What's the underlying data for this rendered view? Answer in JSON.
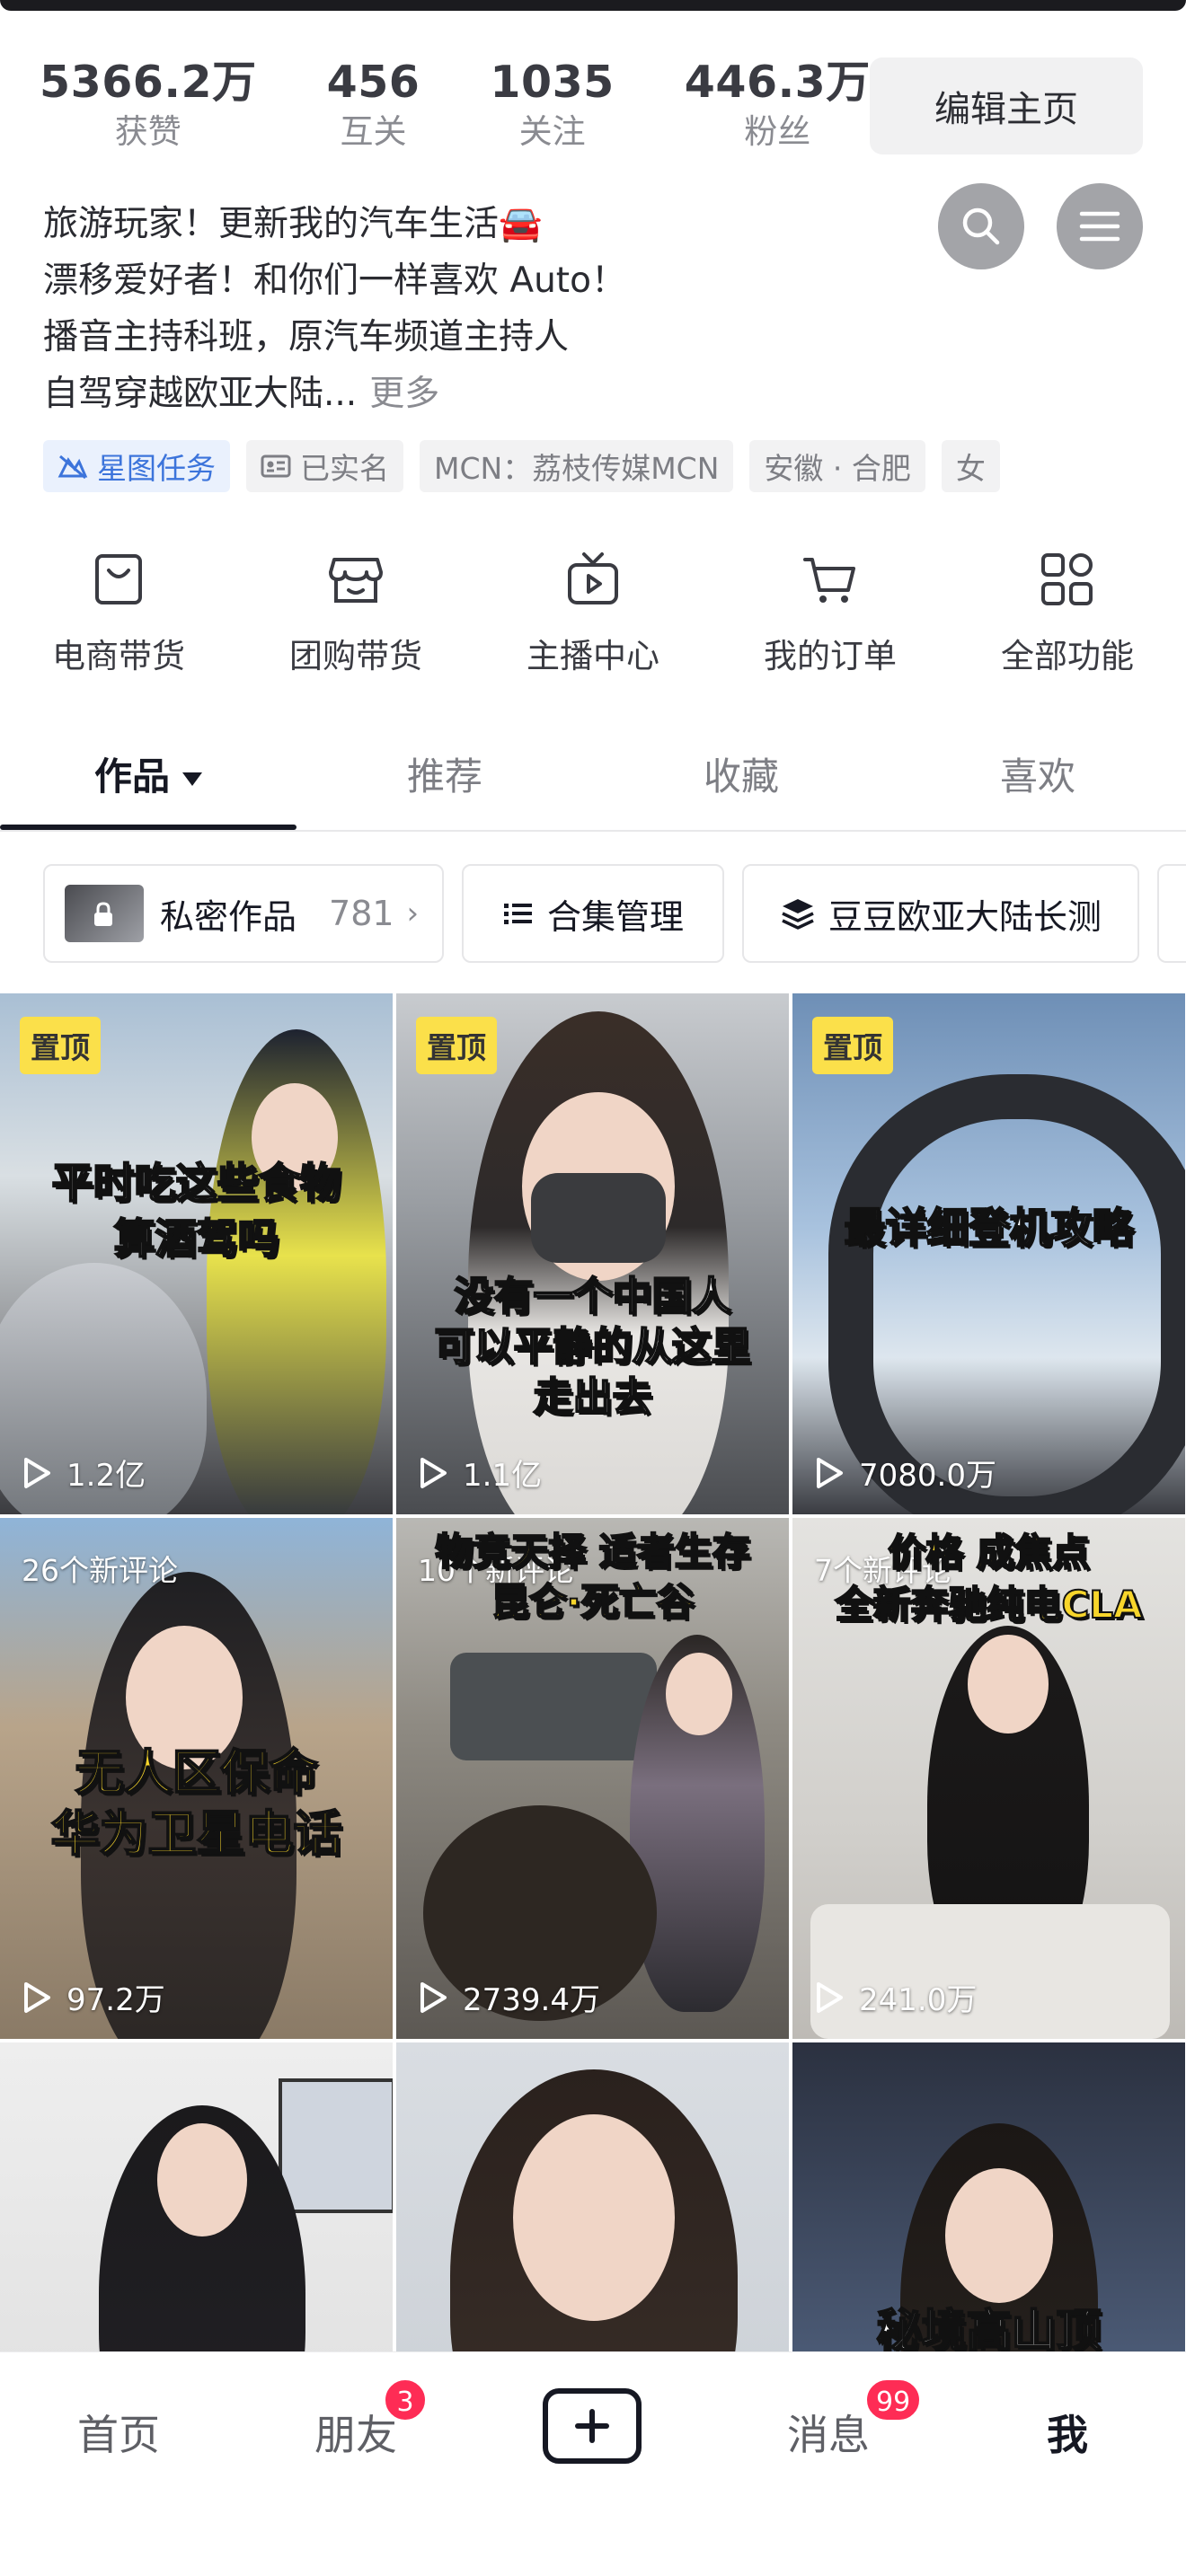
{
  "stats": [
    {
      "num": "5366.2万",
      "label": "获赞"
    },
    {
      "num": "456",
      "label": "互关"
    },
    {
      "num": "1035",
      "label": "关注"
    },
    {
      "num": "446.3万",
      "label": "粉丝"
    }
  ],
  "edit_button": "编辑主页",
  "icons": {
    "search": "search-icon",
    "menu": "menu-icon"
  },
  "bio": {
    "lines": [
      "旅游玩家！更新我的汽车生活🚘",
      "漂移爱好者！和你们一样喜欢 Auto！",
      "播音主持科班，原汽车频道主持人",
      "自驾穿越欧亚大陆..."
    ],
    "more": "更多"
  },
  "tags": [
    "星图任务",
    "已实名",
    "MCN：荔枝传媒MCN",
    "安徽 · 合肥",
    "女"
  ],
  "features": [
    "电商带货",
    "团购带货",
    "主播中心",
    "我的订单",
    "全部功能"
  ],
  "tabs": [
    "作品",
    "推荐",
    "收藏",
    "喜欢"
  ],
  "chips": {
    "private_label": "私密作品",
    "private_count": "781",
    "collection_manage": "合集管理",
    "series": "豆豆欧亚大陆长测"
  },
  "videos": [
    {
      "badge": "置顶",
      "caption": "平时吃这些食物\n算酒驾吗",
      "views": "1.2亿"
    },
    {
      "badge": "置顶",
      "caption": "没有一个中国人\n可以平静的从这里\n走出去",
      "views": "1.1亿"
    },
    {
      "badge": "置顶",
      "caption": "最详细登机攻略",
      "views": "7080.0万"
    },
    {
      "comments": "26个新评论",
      "caption": "无人区保命\n华为卫星电话",
      "views": "97.2万"
    },
    {
      "comments": "10个新评论",
      "caption": "物竞天择 适者生存\n昆仑·死亡谷",
      "views": "2739.4万"
    },
    {
      "comments": "7个新评论",
      "caption": "价格 成焦点\n全新奔驰纯电CLA",
      "views": "241.0万"
    },
    {
      "caption": ""
    },
    {
      "caption": ""
    },
    {
      "caption": "秘境高山顶"
    }
  ],
  "bottom_nav": {
    "home": "首页",
    "friends": "朋友",
    "friends_badge": "3",
    "messages": "消息",
    "messages_badge": "99",
    "me": "我"
  }
}
